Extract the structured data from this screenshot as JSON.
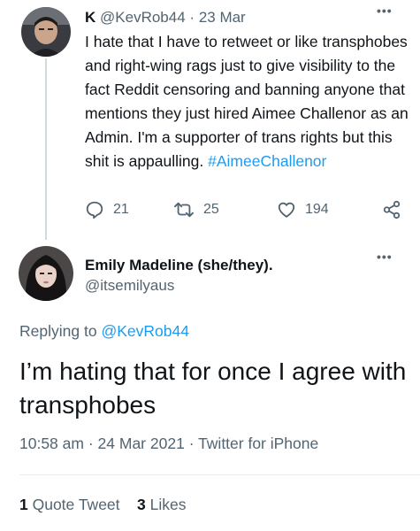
{
  "tweet1": {
    "display_name": "K",
    "handle": "@KevRob44",
    "separator": "·",
    "date": "23 Mar",
    "text": "I hate that I have to retweet or like transphobes and right-wing rags just to give visibility to the fact Reddit  censoring and banning anyone that mentions they just hired Aimee Challenor as an Admin. I'm a supporter of trans rights but this shit is appaulling.",
    "hashtag": "#AimeeChallenor",
    "actions": {
      "replies": "21",
      "retweets": "25",
      "likes": "194"
    },
    "more": "•••"
  },
  "tweet2": {
    "display_name": "Emily Madeline (she/they).",
    "handle": "@itsemilyaus",
    "more": "•••",
    "replying_prefix": "Replying to",
    "replying_to": "@KevRob44",
    "text": "I’m hating that for once I agree with transphobes",
    "time": "10:58 am",
    "date": "24 Mar 2021",
    "source": "Twitter for iPhone",
    "quote_count": "1",
    "quote_label": "Quote Tweet",
    "like_count": "3",
    "like_label": "Likes"
  },
  "colors": {
    "accent": "#1d9bf0",
    "muted": "#536471",
    "text": "#0f1419"
  },
  "icons": [
    "reply-icon",
    "retweet-icon",
    "like-icon",
    "share-icon",
    "more-icon"
  ]
}
